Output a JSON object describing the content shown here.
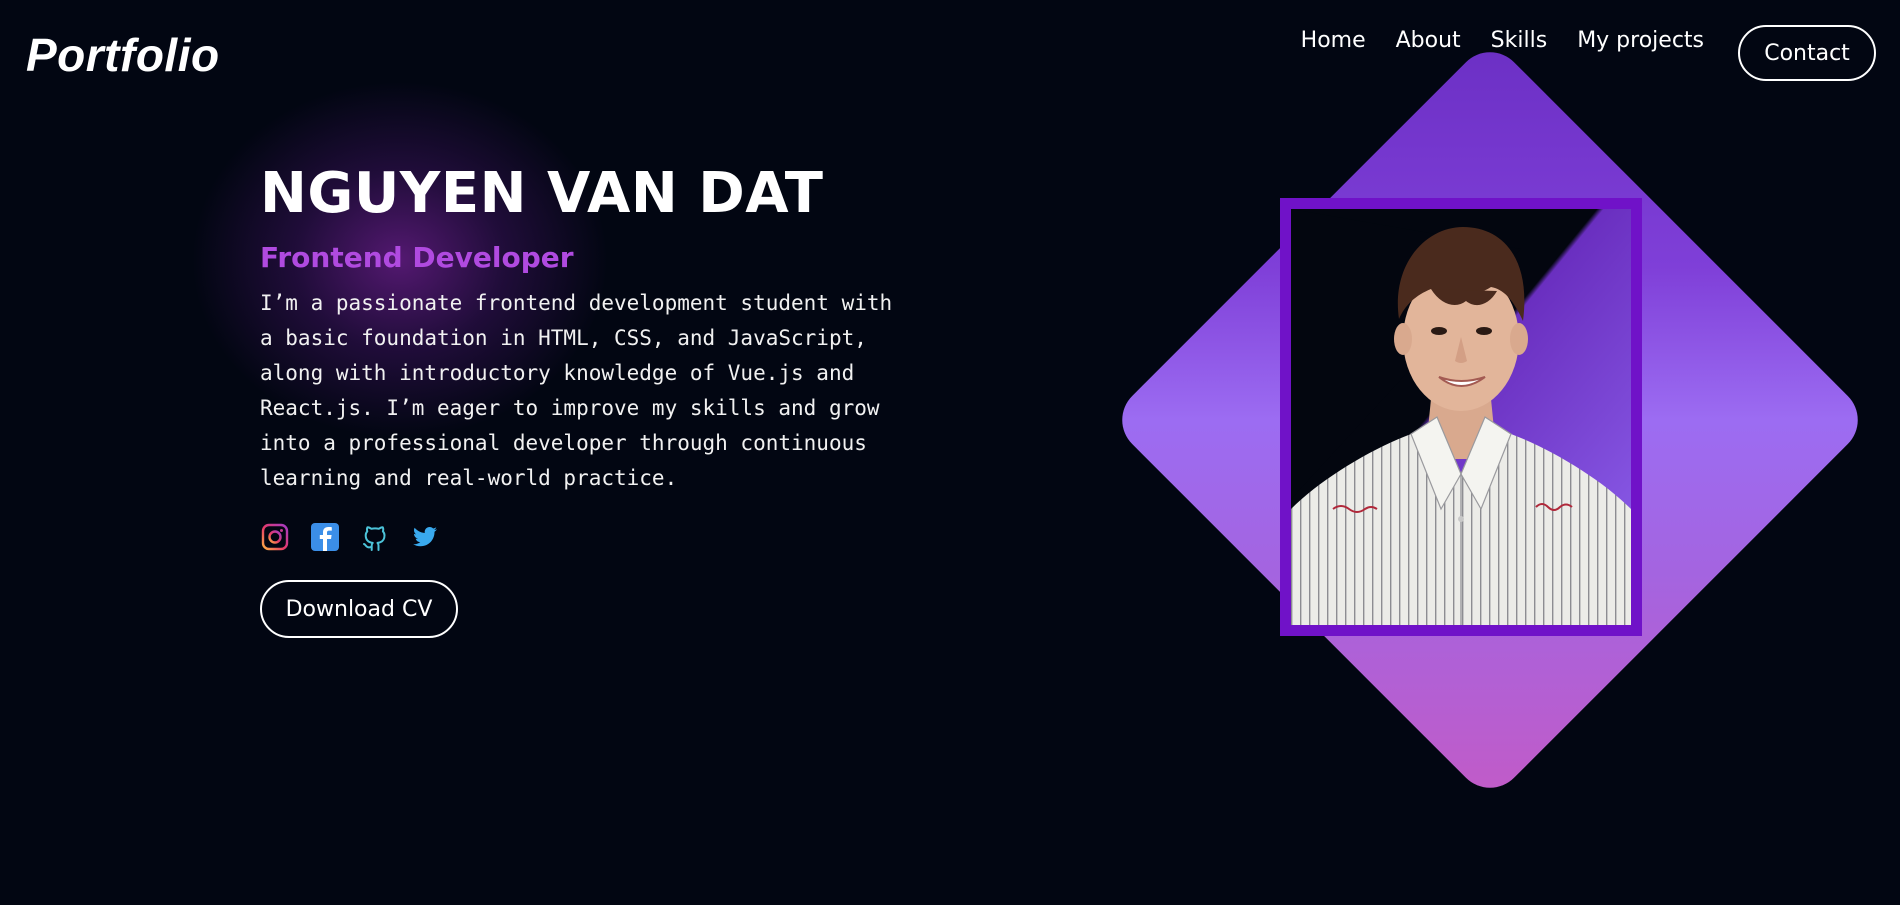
{
  "header": {
    "logo": "Portfolio",
    "nav": [
      "Home",
      "About",
      "Skills",
      "My projects"
    ],
    "contact_label": "Contact"
  },
  "hero": {
    "name": "NGUYEN VAN DAT",
    "role": "Frontend Developer",
    "description": "I’m a passionate frontend development student with a basic foundation in HTML, CSS, and JavaScript, along with introductory knowledge of Vue.js and React.js. I’m eager to improve my skills and grow into a professional developer through continuous learning and real-world practice.",
    "desc_lines": [
      "I’m a passionate frontend development student with",
      "a basic foundation in HTML, CSS, and JavaScript,",
      "along with introductory knowledge of Vue.js and",
      "React.js. I’m eager to improve my skills and grow",
      "into a professional developer through continuous",
      "learning and real-world practice."
    ],
    "socials": [
      "instagram-icon",
      "facebook-icon",
      "github-icon",
      "twitter-icon"
    ],
    "download_label": "Download CV"
  },
  "colors": {
    "background": "#020612",
    "accent": "#b04ae0",
    "frame": "#7012c8"
  }
}
